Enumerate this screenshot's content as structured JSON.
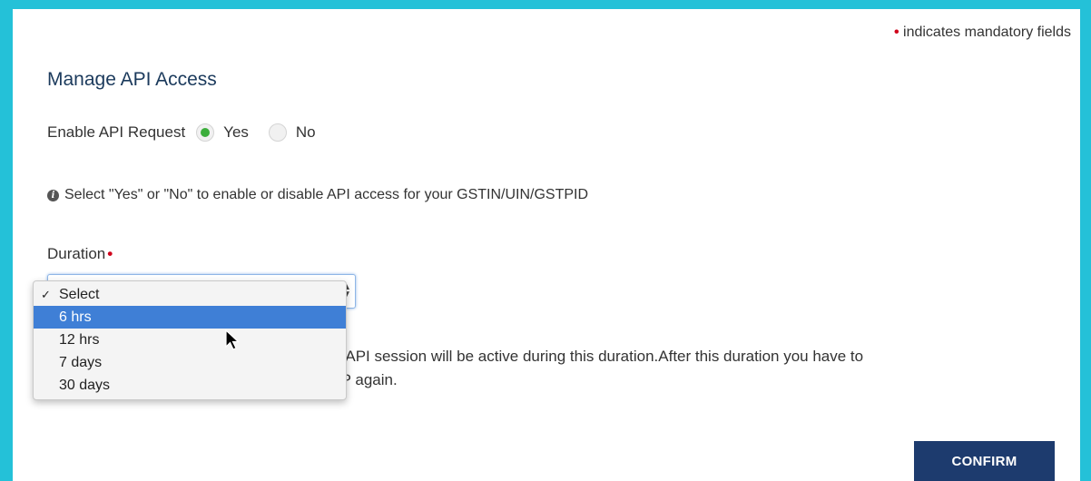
{
  "mandatory_note": {
    "asterisk": "•",
    "text": "indicates mandatory fields"
  },
  "section_title": "Manage API Access",
  "api_request": {
    "label": "Enable API Request",
    "options": [
      {
        "label": "Yes",
        "selected": true
      },
      {
        "label": "No",
        "selected": false
      }
    ]
  },
  "info": {
    "icon": "info-circle-icon",
    "text": "Select \"Yes\" or \"No\" to enable or disable API access for your GSTIN/UIN/GSTPID"
  },
  "duration": {
    "label": "Duration",
    "required_marker": "•",
    "selected_value": "Select",
    "options": [
      {
        "label": "Select",
        "checked": true,
        "highlighted": false
      },
      {
        "label": "6 hrs",
        "checked": false,
        "highlighted": true
      },
      {
        "label": "12 hrs",
        "checked": false,
        "highlighted": false
      },
      {
        "label": "7 days",
        "checked": false,
        "highlighted": false
      },
      {
        "label": "30 days",
        "checked": false,
        "highlighted": false
      }
    ],
    "help_line1": "our API session will be active during this duration.After this duration you have to",
    "help_line2": "OTP again."
  },
  "confirm_label": "CONFIRM",
  "colors": {
    "background": "#24c1d8",
    "radio_selected": "#3cae3c",
    "highlight": "#3f7fd6",
    "button": "#1d3b6e",
    "required": "#d0021b"
  }
}
